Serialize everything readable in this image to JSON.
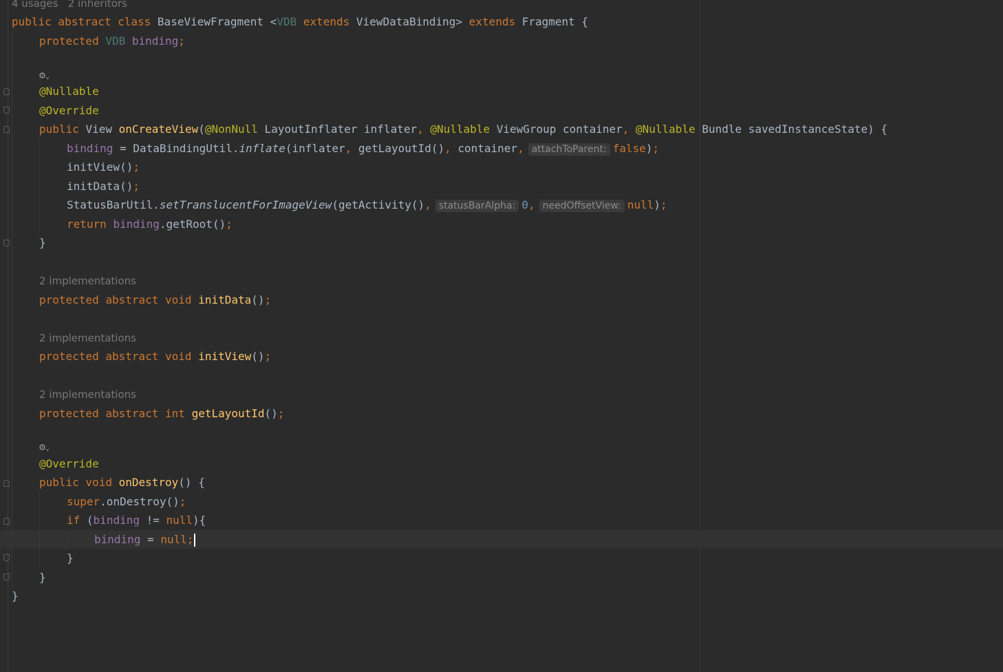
{
  "editor": {
    "usages_hint": "4 usages",
    "inheritors_hint": "2 inheritors",
    "implementations_hint": "2 implementations",
    "inlays": {
      "attach_to_parent": "attachToParent:",
      "status_bar_alpha": "statusBarAlpha:",
      "need_offset_view": "needOffsetView:"
    },
    "icons": [
      "gear-icon",
      "chevron-down-icon",
      "fold-marker-icon"
    ],
    "colors": {
      "background": "#2b2b2b",
      "keyword": "#cc7832",
      "method": "#ffc66d",
      "field": "#9876aa",
      "annotation": "#bbb529",
      "type_param": "#507874",
      "number": "#6897bb",
      "text": "#a9b7c6"
    }
  }
}
